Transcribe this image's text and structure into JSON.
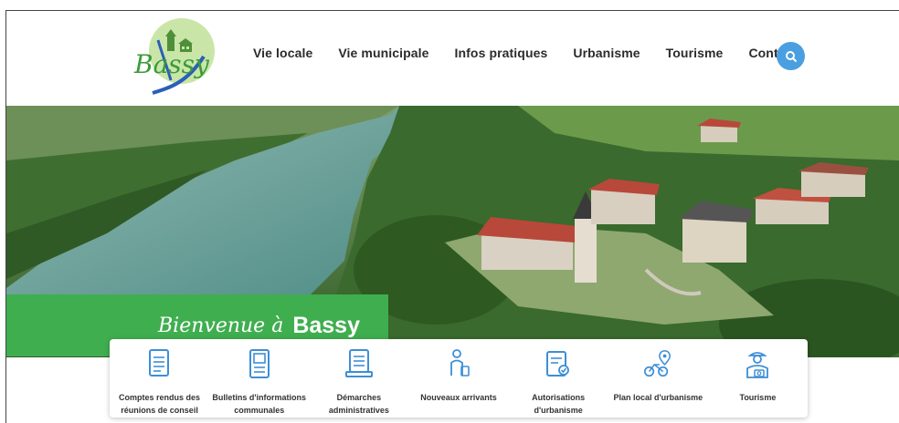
{
  "header": {
    "logo_text": "Bassy",
    "nav": [
      {
        "label": "Vie locale"
      },
      {
        "label": "Vie municipale"
      },
      {
        "label": "Infos pratiques"
      },
      {
        "label": "Urbanisme"
      },
      {
        "label": "Tourisme"
      },
      {
        "label": "Contact"
      }
    ],
    "search_icon": "search-icon"
  },
  "hero": {
    "welcome_prefix": "Bienvenue à",
    "welcome_name": "Bassy"
  },
  "quick_links": [
    {
      "label": "Comptes rendus des réunions de conseil",
      "icon": "document-icon"
    },
    {
      "label": "Bulletins d'informations communales",
      "icon": "bulletin-icon"
    },
    {
      "label": "Démarches administratives",
      "icon": "admin-procedure-icon"
    },
    {
      "label": "Nouveaux arrivants",
      "icon": "new-arrival-icon"
    },
    {
      "label": "Autorisations d'urbanisme",
      "icon": "building-permit-icon"
    },
    {
      "label": "Plan local d'urbanisme",
      "icon": "urban-plan-icon"
    },
    {
      "label": "Tourisme",
      "icon": "tourism-icon"
    }
  ],
  "colors": {
    "accent_green": "#3fae4f",
    "icon_blue": "#3d8fd6",
    "search_blue": "#4a9fe0"
  }
}
